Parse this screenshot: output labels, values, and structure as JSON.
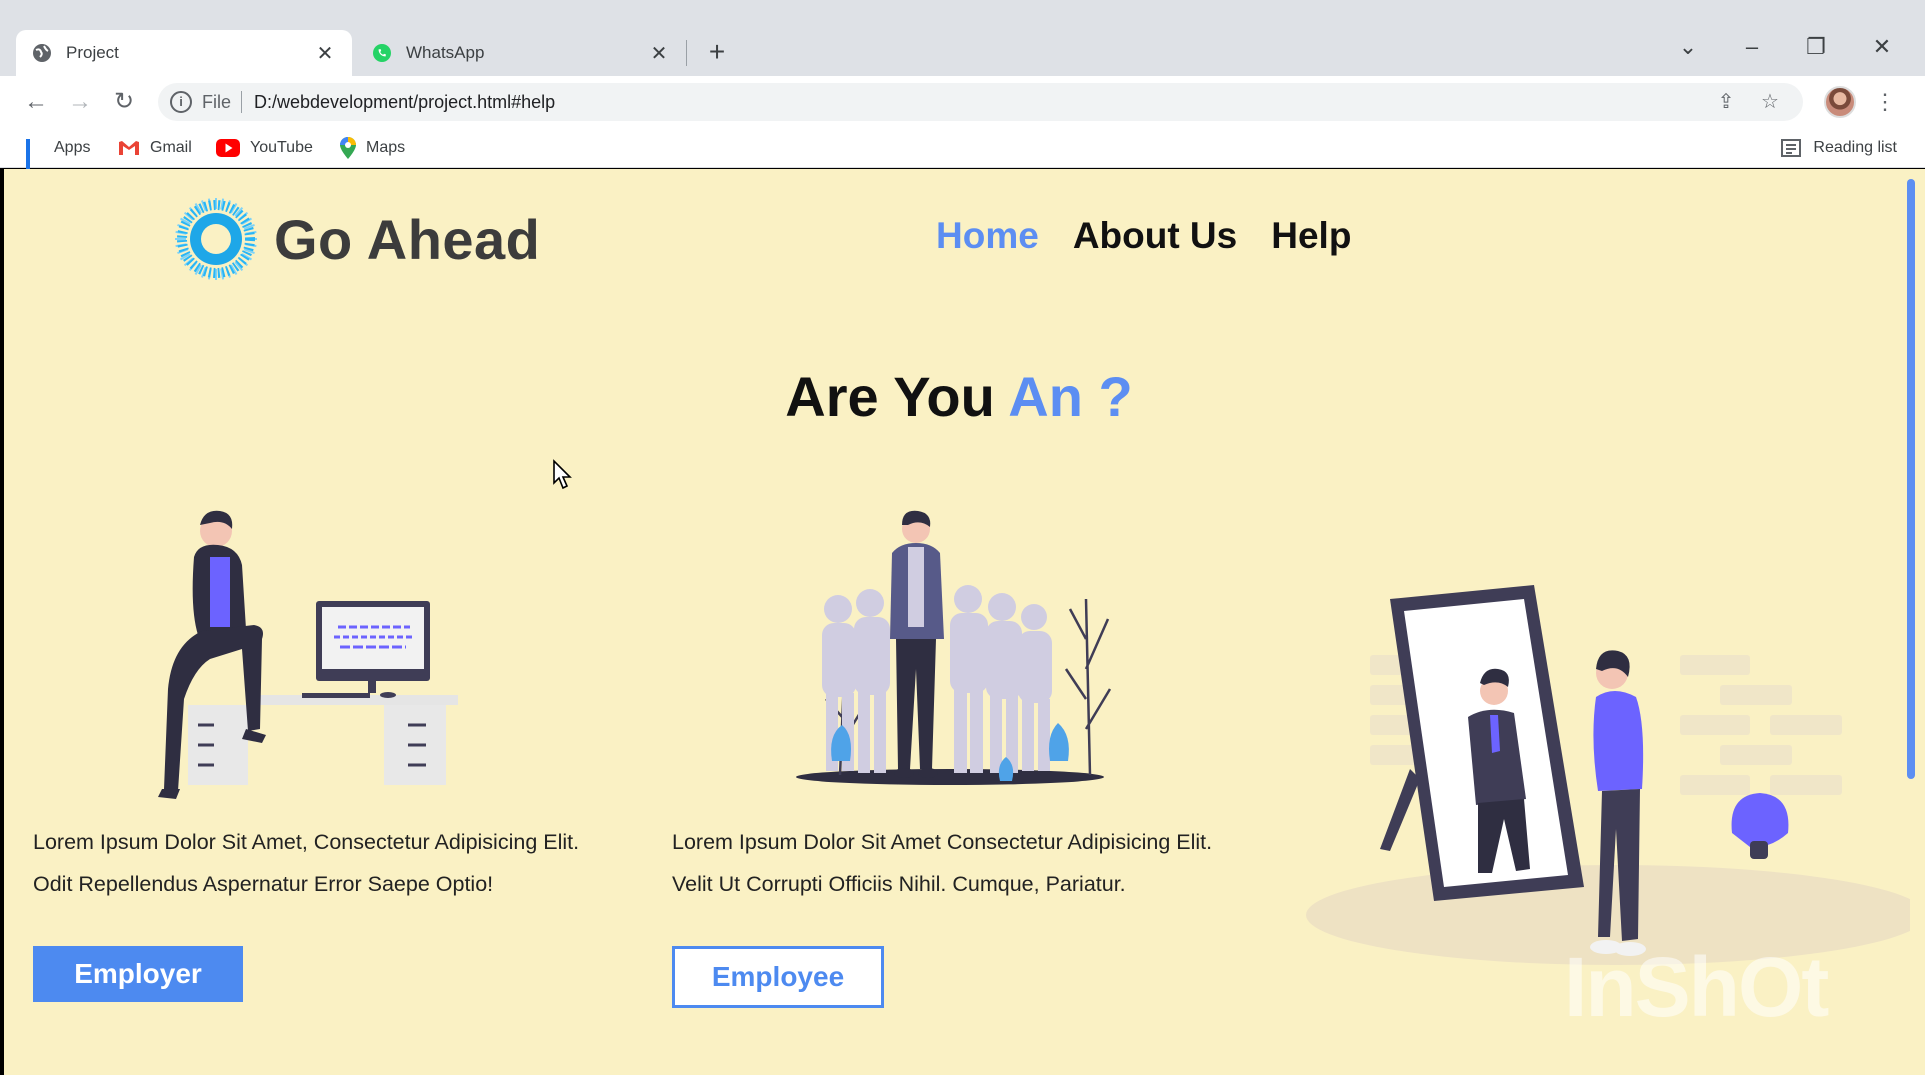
{
  "browser": {
    "tabs": [
      {
        "title": "Project",
        "active": true
      },
      {
        "title": "WhatsApp",
        "active": false
      }
    ],
    "address": {
      "scheme": "File",
      "url": "D:/webdevelopment/project.html#help"
    },
    "bookmarks": [
      "Apps",
      "Gmail",
      "YouTube",
      "Maps"
    ],
    "reading_list": "Reading list"
  },
  "page": {
    "brand": "Go Ahead",
    "nav": [
      "Home",
      "About Us",
      "Help"
    ],
    "heading": {
      "main": "Are You ",
      "highlight": "An ?"
    },
    "employer": {
      "line1": "Lorem Ipsum Dolor Sit Amet, Consectetur Adipisicing Elit.",
      "line2": "Odit Repellendus Aspernatur Error Saepe Optio!",
      "button": "Employer"
    },
    "employee": {
      "line1": "Lorem Ipsum Dolor Sit Amet Consectetur Adipisicing Elit.",
      "line2": "Velit Ut Corrupti Officiis Nihil. Cumque, Pariatur.",
      "button": "Employee"
    },
    "watermark": "InShOt"
  },
  "colors": {
    "accent": "#5c8ef2",
    "background": "#faf1c4",
    "purple": "#6c63ff"
  }
}
